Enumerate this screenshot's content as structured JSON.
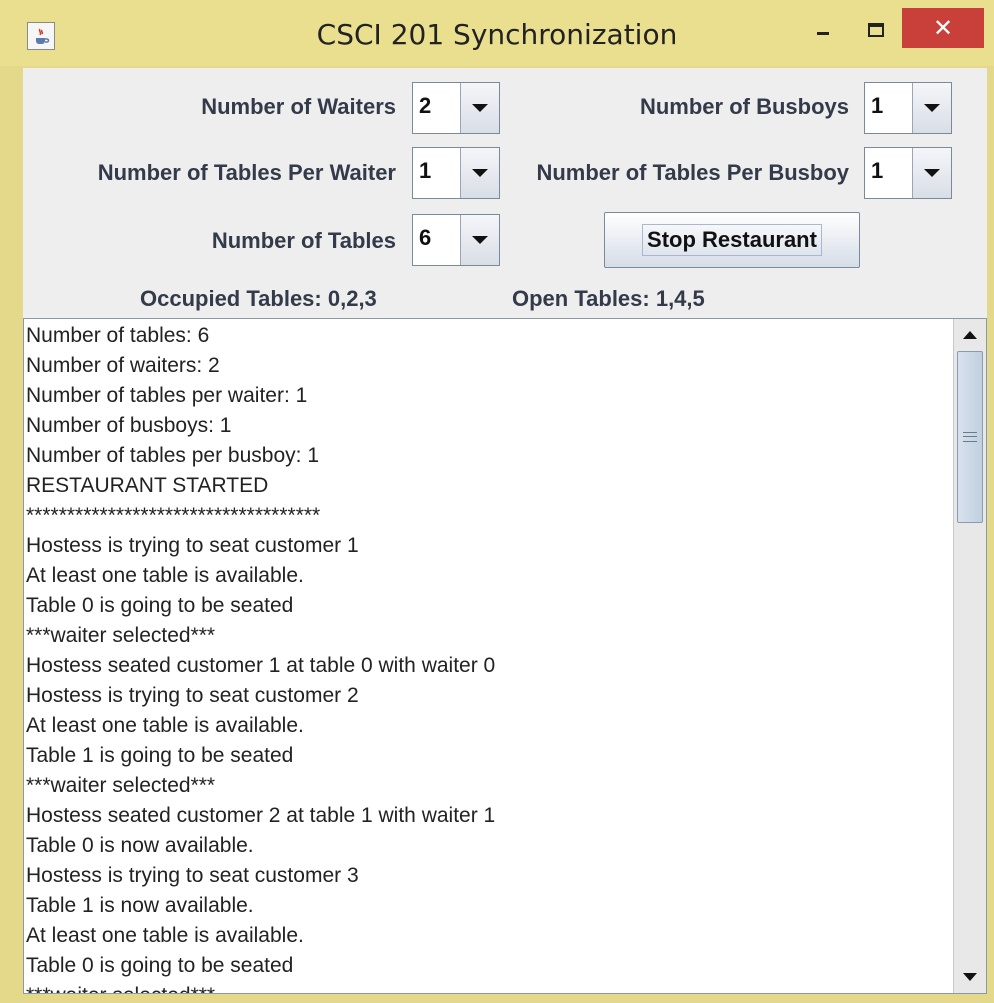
{
  "window": {
    "title": "CSCI 201 Synchronization",
    "minimize_glyph": "—",
    "maximize_glyph": "☐",
    "close_glyph": "✕",
    "app_icon": "java-cup-icon"
  },
  "controls": {
    "waiters_label": "Number of Waiters",
    "waiters_value": "2",
    "busboys_label": "Number of Busboys",
    "busboys_value": "1",
    "tables_per_waiter_label": "Number of Tables Per Waiter",
    "tables_per_waiter_value": "1",
    "tables_per_busboy_label": "Number of Tables Per Busboy",
    "tables_per_busboy_value": "1",
    "tables_label": "Number of Tables",
    "tables_value": "6",
    "stop_button_label": "Stop Restaurant"
  },
  "status": {
    "occupied": "Occupied Tables: 0,2,3",
    "open": "Open Tables: 1,4,5"
  },
  "log": {
    "lines": [
      "Number of tables: 6",
      "Number of waiters: 2",
      "Number of tables per waiter: 1",
      "Number of busboys: 1",
      "Number of tables per busboy: 1",
      "RESTAURANT STARTED",
      "************************************",
      "Hostess is trying to seat customer 1",
      "At least one table is available.",
      "Table 0 is going to be seated",
      "***waiter selected***",
      "Hostess seated customer 1 at table 0 with waiter 0",
      "Hostess is trying to seat customer 2",
      "At least one table is available.",
      "Table 1 is going to be seated",
      "***waiter selected***",
      "Hostess seated customer 2 at table 1 with waiter 1",
      "Table 0 is now available.",
      "Hostess is trying to seat customer 3",
      "Table 1 is now available.",
      "At least one table is available.",
      "Table 0 is going to be seated",
      "***waiter selected***"
    ]
  },
  "colors": {
    "title_bar": "#e9df8f",
    "close_button": "#c9403a",
    "panel": "#eeeeee"
  }
}
